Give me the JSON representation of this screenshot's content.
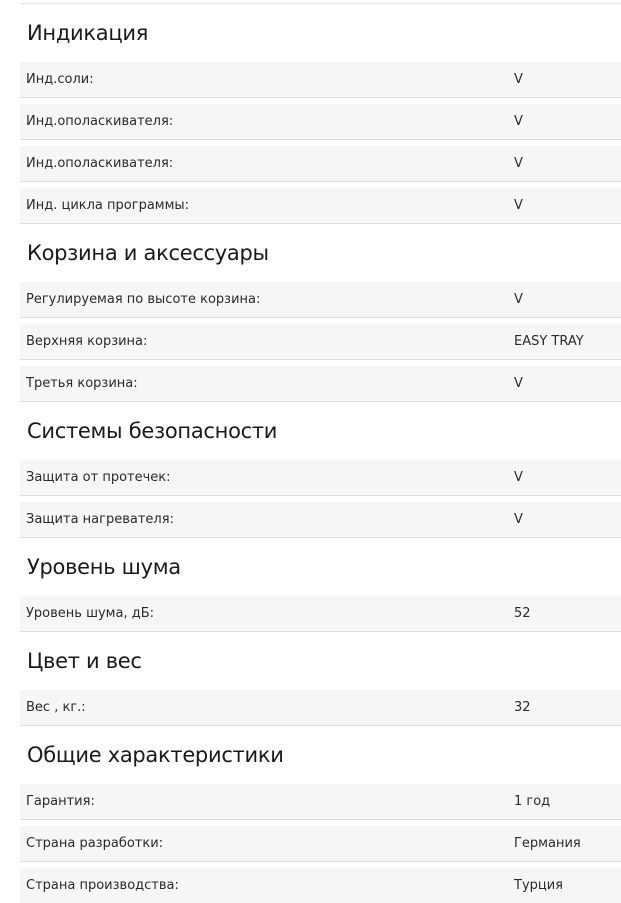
{
  "sections": [
    {
      "title": "Индикация",
      "rows": [
        {
          "label": "Инд.соли:",
          "value": "V"
        },
        {
          "label": "Инд.ополаскивателя:",
          "value": "V"
        },
        {
          "label": "Инд.ополаскивателя:",
          "value": "V"
        },
        {
          "label": "Инд. цикла программы:",
          "value": "V"
        }
      ]
    },
    {
      "title": "Корзина и аксессуары",
      "rows": [
        {
          "label": "Регулируемая по высоте корзина:",
          "value": "V"
        },
        {
          "label": "Верхняя корзина:",
          "value": "EASY TRAY"
        },
        {
          "label": "Третья корзина:",
          "value": "V"
        }
      ]
    },
    {
      "title": "Системы безопасности",
      "rows": [
        {
          "label": "Защита от протечек:",
          "value": "V"
        },
        {
          "label": "Защита нагревателя:",
          "value": "V"
        }
      ]
    },
    {
      "title": "Уровень шума",
      "rows": [
        {
          "label": "Уровень шума, дБ:",
          "value": "52"
        }
      ]
    },
    {
      "title": "Цвет и вес",
      "rows": [
        {
          "label": "Вес , кг.:",
          "value": "32"
        }
      ]
    },
    {
      "title": "Общие характеристики",
      "rows": [
        {
          "label": "Гарантия:",
          "value": "1 год"
        },
        {
          "label": "Страна разработки:",
          "value": "Германия"
        },
        {
          "label": "Страна производства:",
          "value": "Турция"
        }
      ]
    }
  ]
}
